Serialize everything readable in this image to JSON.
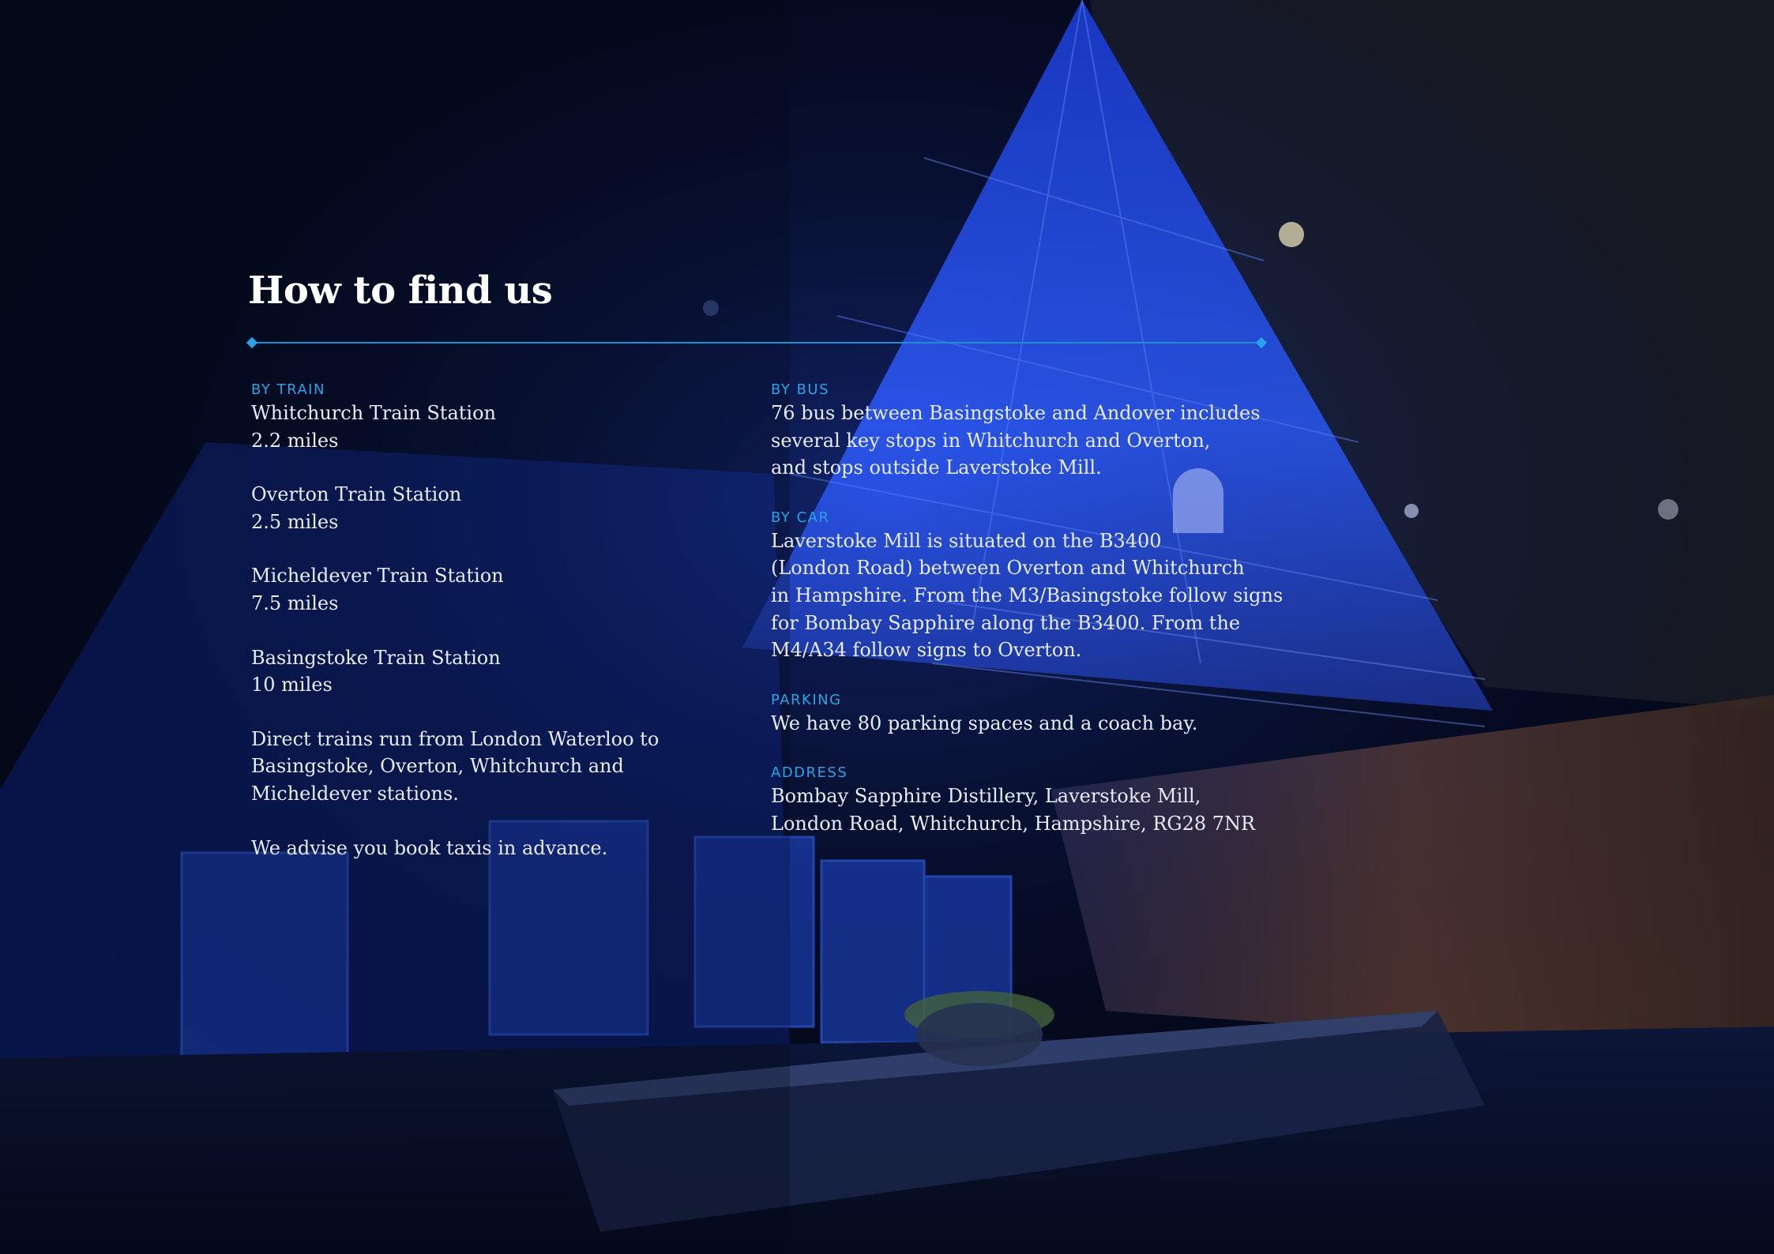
{
  "page": {
    "title": "How to find us",
    "accent_color": "#2aa3e8",
    "text_color": "#e8ecf6"
  },
  "by_train": {
    "label": "BY TRAIN",
    "stations": [
      {
        "name": "Whitchurch Train Station",
        "distance": "2.2 miles"
      },
      {
        "name": "Overton Train Station",
        "distance": "2.5 miles"
      },
      {
        "name": "Micheldever Train Station",
        "distance": "7.5 miles"
      },
      {
        "name": "Basingstoke Train Station",
        "distance": "10 miles"
      }
    ],
    "direct_trains": "Direct trains run from London Waterloo to\nBasingstoke, Overton, Whitchurch and\nMicheldever stations.",
    "taxi_advice": "We advise you book taxis in advance."
  },
  "by_bus": {
    "label": "BY BUS",
    "text": "76 bus between Basingstoke and Andover includes\nseveral key stops in Whitchurch and Overton,\nand stops outside Laverstoke Mill."
  },
  "by_car": {
    "label": "BY CAR",
    "text": "Laverstoke Mill is situated on the B3400\n(London Road) between Overton and Whitchurch\nin Hampshire. From the M3/Basingstoke follow signs\nfor Bombay Sapphire along the B3400. From the\nM4/A34 follow signs to Overton."
  },
  "parking": {
    "label": "PARKING",
    "text": "We have 80 parking spaces and a coach bay."
  },
  "address": {
    "label": "ADDRESS",
    "text": "Bombay Sapphire Distillery, Laverstoke Mill,\nLondon Road, Whitchurch, Hampshire, RG28 7NR"
  }
}
